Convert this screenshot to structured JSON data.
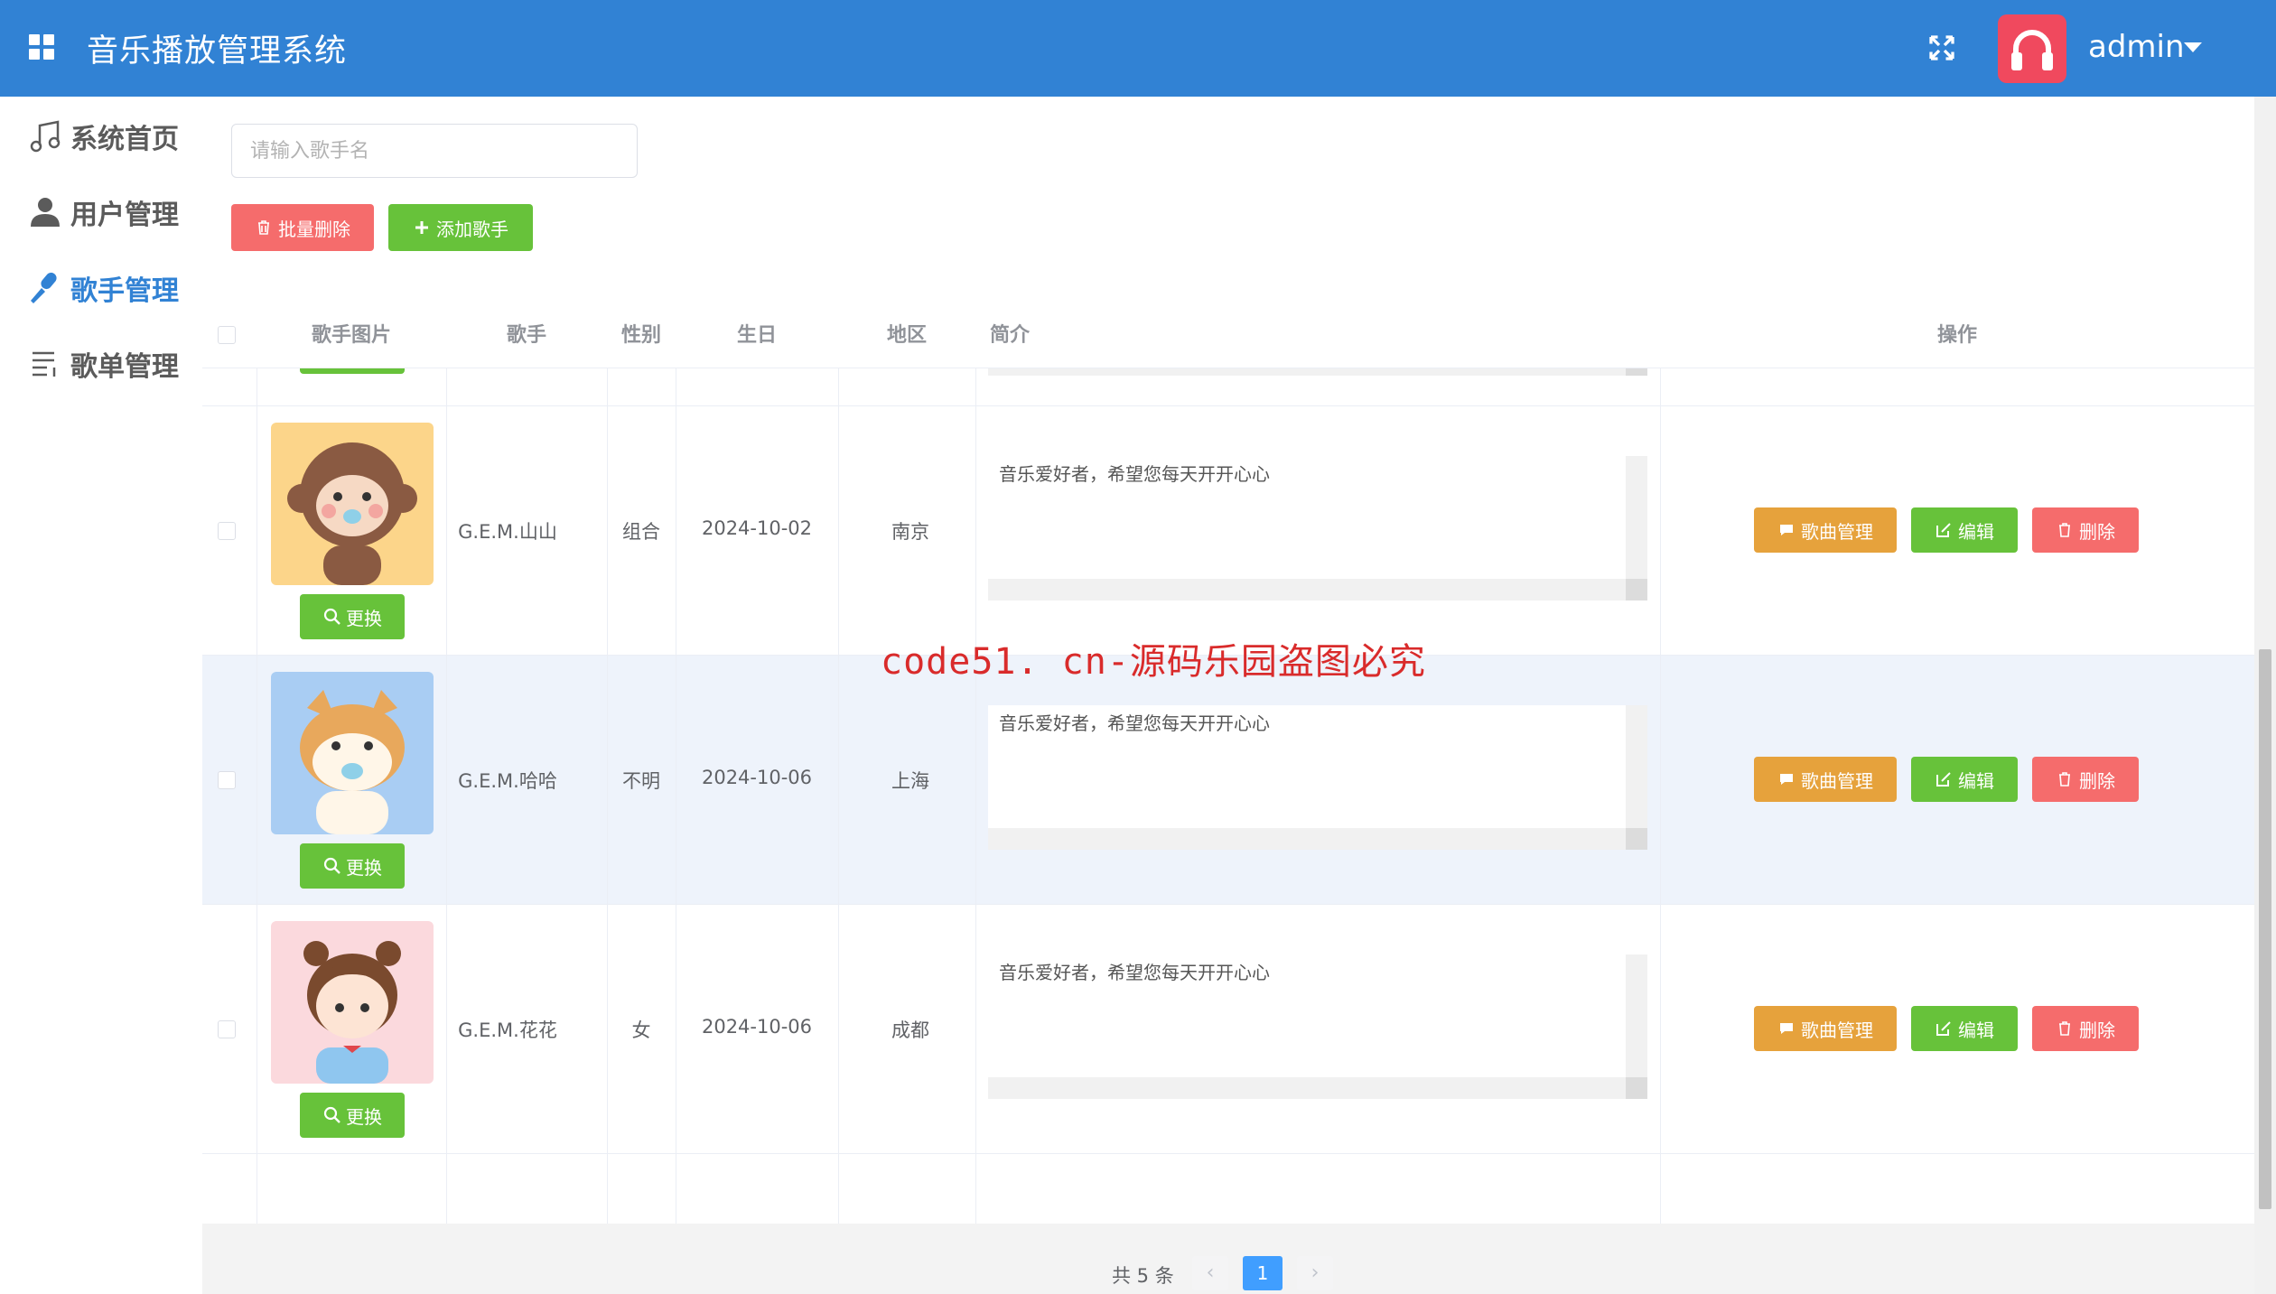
{
  "header": {
    "title": "音乐播放管理系统",
    "username": "admin"
  },
  "sidebar": {
    "items": [
      {
        "label": "系统首页",
        "icon": "music-note-icon",
        "active": false
      },
      {
        "label": "用户管理",
        "icon": "user-icon",
        "active": false
      },
      {
        "label": "歌手管理",
        "icon": "microphone-icon",
        "active": true
      },
      {
        "label": "歌单管理",
        "icon": "playlist-icon",
        "active": false
      }
    ]
  },
  "toolbar": {
    "search_placeholder": "请输入歌手名",
    "batch_delete_label": "批量删除",
    "add_singer_label": "添加歌手"
  },
  "table": {
    "columns": [
      "歌手图片",
      "歌手",
      "性别",
      "生日",
      "地区",
      "简介",
      "操作"
    ],
    "change_label": "更换",
    "song_manage_label": "歌曲管理",
    "edit_label": "编辑",
    "delete_label": "删除",
    "rows": [
      {
        "name": "G.E.M.山山",
        "gender": "组合",
        "birthday": "2024-10-02",
        "region": "南京",
        "intro": "音乐爱好者，希望您每天开开心心"
      },
      {
        "name": "G.E.M.哈哈",
        "gender": "不明",
        "birthday": "2024-10-06",
        "region": "上海",
        "intro": "音乐爱好者，希望您每天开开心心"
      },
      {
        "name": "G.E.M.花花",
        "gender": "女",
        "birthday": "2024-10-06",
        "region": "成都",
        "intro": "音乐爱好者，希望您每天开开心心"
      }
    ]
  },
  "pagination": {
    "total_text": "共 5 条",
    "current_page": "1"
  },
  "watermark": {
    "red_text": "code51. cn-源码乐园盗图必究"
  },
  "colors": {
    "header": "#3182d4",
    "primary": "#409eff",
    "success": "#67c23a",
    "warning": "#e6a23c",
    "danger": "#f56c6c"
  }
}
